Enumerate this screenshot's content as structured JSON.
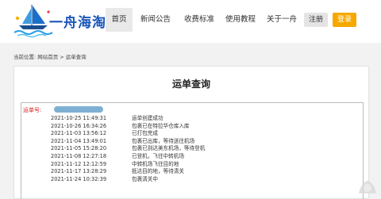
{
  "header": {
    "logo_text": "一舟海淘",
    "nav": [
      {
        "label": "首页",
        "active": true
      },
      {
        "label": "新闻公告",
        "active": false
      },
      {
        "label": "收费标准",
        "active": false
      },
      {
        "label": "使用教程",
        "active": false
      },
      {
        "label": "关于一舟",
        "active": false
      }
    ],
    "register_label": "注册",
    "login_label": "登录"
  },
  "breadcrumb": {
    "prefix": "当前位置:",
    "home": "网站首页",
    "separator": ">",
    "current": "运单查询"
  },
  "main": {
    "title": "运单查询",
    "waybill_label": "运单号:",
    "tracking": [
      {
        "time": "2021-10-25 11:49:31",
        "status": "运单创建成功"
      },
      {
        "time": "2021-10-26 16:34:26",
        "status": "包裹已在特拉华仓库入库"
      },
      {
        "time": "2021-11-03 13:56:12",
        "status": "已打包完成"
      },
      {
        "time": "2021-11-04 13:49:01",
        "status": "包裹已出库，等待送往机场"
      },
      {
        "time": "2021-11-05 15:28:20",
        "status": "包裹已到达美东机场，等待登机"
      },
      {
        "time": "2021-11-08 12:27:18",
        "status": "已登机，飞往中转机场"
      },
      {
        "time": "2021-11-12 12:12:59",
        "status": "中转机场飞往目的地"
      },
      {
        "time": "2021-11-17 13:28:29",
        "status": "抵达目的地，等待清关"
      },
      {
        "time": "2021-11-24 10:32:39",
        "status": "包裹清关中"
      }
    ]
  },
  "colors": {
    "login_button": "#f6a800",
    "waybill_label": "#e02020",
    "logo_text": "#1a56b8"
  }
}
